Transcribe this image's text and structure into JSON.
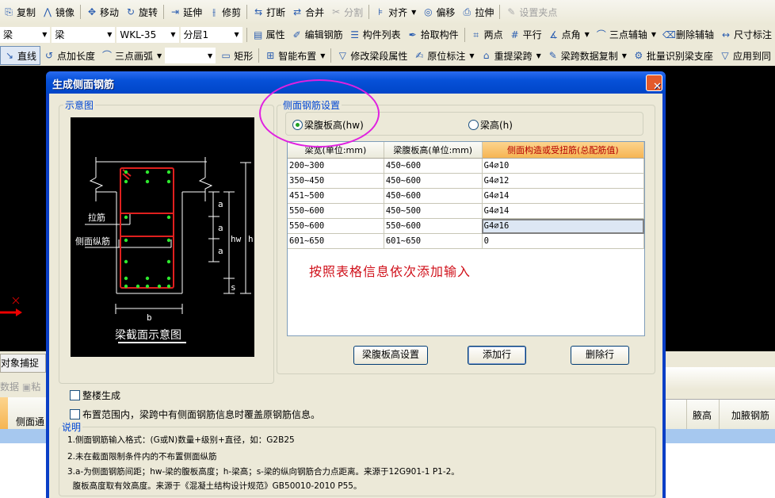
{
  "toolbar1": [
    {
      "icon": "copy-icon",
      "glyph": "⎘",
      "label": "复制"
    },
    {
      "icon": "mirror-icon",
      "glyph": "⋀",
      "label": "镜像"
    },
    {
      "icon": "move-icon",
      "glyph": "✥",
      "label": "移动"
    },
    {
      "icon": "rotate-icon",
      "glyph": "↻",
      "label": "旋转"
    },
    {
      "icon": "extend-icon",
      "glyph": "⇥",
      "label": "延伸"
    },
    {
      "icon": "trim-icon",
      "glyph": "⫲",
      "label": "修剪"
    },
    {
      "icon": "break-icon",
      "glyph": "⇆",
      "label": "打断"
    },
    {
      "icon": "merge-icon",
      "glyph": "⇄",
      "label": "合并"
    },
    {
      "icon": "split-icon",
      "glyph": "✂",
      "label": "分割",
      "disabled": true
    },
    {
      "icon": "align-icon",
      "glyph": "⊧",
      "label": "对齐",
      "dropdown": true
    },
    {
      "icon": "offset-icon",
      "glyph": "◎",
      "label": "偏移"
    },
    {
      "icon": "stretch-icon",
      "glyph": "⎙",
      "label": "拉伸"
    },
    {
      "icon": "grip-icon",
      "glyph": "✎",
      "label": "设置夹点",
      "disabled": true
    }
  ],
  "toolbar2": {
    "combos": [
      {
        "value": "梁"
      },
      {
        "value": "梁"
      },
      {
        "value": "WKL-35"
      },
      {
        "value": "分层1"
      }
    ],
    "items": [
      {
        "icon": "properties-icon",
        "glyph": "▤",
        "label": "属性"
      },
      {
        "icon": "edit-rebar-icon",
        "glyph": "✐",
        "label": "编辑钢筋"
      },
      {
        "icon": "component-list-icon",
        "glyph": "☰",
        "label": "构件列表"
      },
      {
        "icon": "pick-component-icon",
        "glyph": "✒",
        "label": "拾取构件"
      },
      {
        "icon": "two-point-icon",
        "glyph": "⌗",
        "label": "两点"
      },
      {
        "icon": "parallel-icon",
        "glyph": "#",
        "label": "平行"
      },
      {
        "icon": "point-angle-icon",
        "glyph": "∡",
        "label": "点角",
        "dropdown": true
      },
      {
        "icon": "three-point-axis-icon",
        "glyph": "⌒",
        "label": "三点辅轴",
        "dropdown": true
      },
      {
        "icon": "delete-axis-icon",
        "glyph": "⌫",
        "label": "删除辅轴"
      },
      {
        "icon": "dimension-icon",
        "glyph": "↔",
        "label": "尺寸标注"
      }
    ]
  },
  "toolbar3": {
    "items_a": [
      {
        "icon": "line-icon",
        "glyph": "↘",
        "label": "直线",
        "pressed": true
      },
      {
        "icon": "point-length-icon",
        "glyph": "↺",
        "label": "点加长度"
      },
      {
        "icon": "arc-icon",
        "glyph": "⌒",
        "label": "三点画弧",
        "dropdown": true
      }
    ],
    "combo": {
      "value": ""
    },
    "items_b": [
      {
        "icon": "rectangle-icon",
        "glyph": "▭",
        "label": "矩形"
      },
      {
        "icon": "smart-layout-icon",
        "glyph": "⊞",
        "label": "智能布置",
        "dropdown": true
      },
      {
        "icon": "modify-span-icon",
        "glyph": "▽",
        "label": "修改梁段属性"
      },
      {
        "icon": "in-place-label-icon",
        "glyph": "✍",
        "label": "原位标注",
        "dropdown": true
      },
      {
        "icon": "re-extract-span-icon",
        "glyph": "⌂",
        "label": "重提梁跨",
        "dropdown": true
      },
      {
        "icon": "span-copy-icon",
        "glyph": "✎",
        "label": "梁跨数据复制",
        "dropdown": true
      },
      {
        "icon": "batch-support-icon",
        "glyph": "⚙",
        "label": "批量识别梁支座"
      },
      {
        "icon": "apply-same-icon",
        "glyph": "▽",
        "label": "应用到同"
      }
    ]
  },
  "background": {
    "snap_label": "对象捕捉",
    "data_label": "数据",
    "paste_label": "粘",
    "col_side": "侧面通",
    "col_haunch_height": "腋高",
    "col_haunch_rebar": "加腋钢筋"
  },
  "dialog": {
    "title": "生成侧面钢筋",
    "schematic": {
      "legend": "示意图",
      "tie_label": "拉筋",
      "side_rebar_label": "侧面纵筋",
      "dim_a": "a",
      "dim_hw": "hw",
      "dim_h": "h",
      "dim_s": "s",
      "dim_b": "b",
      "caption": "梁截面示意图"
    },
    "settings": {
      "legend": "侧面钢筋设置",
      "radio_web_height": "梁腹板高(hw)",
      "radio_beam_height": "梁高(h)",
      "selected": "web_height",
      "columns": [
        "梁宽(单位:mm)",
        "梁腹板高(单位:mm)",
        "侧面构造或受扭筋(总配筋值)"
      ],
      "rows": [
        [
          "200~300",
          "450~600",
          "G4⌀10"
        ],
        [
          "350~450",
          "450~600",
          "G4⌀12"
        ],
        [
          "451~500",
          "450~600",
          "G4⌀14"
        ],
        [
          "550~600",
          "450~500",
          "G4⌀14"
        ],
        [
          "550~600",
          "550~600",
          "G4⌀16"
        ],
        [
          "601~650",
          "601~650",
          "0"
        ]
      ],
      "selected_row": 4,
      "annotation": "按照表格信息依次添加输入",
      "btn_web_height": "梁腹板高设置",
      "btn_add_row": "添加行",
      "btn_delete_row": "删除行"
    },
    "check_whole_building": "整楼生成",
    "check_override": "布置范围内，梁跨中有侧面钢筋信息时覆盖原钢筋信息。",
    "notes": {
      "legend": "说明",
      "lines": [
        "1.侧面钢筋输入格式：(G或N)数量+级别+直径，如：G2B25",
        "2.未在截面限制条件内的不布置侧面纵筋",
        "3.a-为侧面钢筋间距；hw-梁的腹板高度；h-梁高；s-梁的纵向钢筋合力点距离。来源于12G901-1 P1-2。",
        "  腹板高度取有效高度。来源于《混凝土结构设计规范》GB50010-2010 P55。"
      ]
    }
  },
  "colors": {
    "header_highlight": "#f6b552",
    "annotation_red": "#d0101a",
    "rebar_red": "#e0201e",
    "rebar_green": "#2ee82e",
    "circle_magenta": "#e020e0"
  }
}
